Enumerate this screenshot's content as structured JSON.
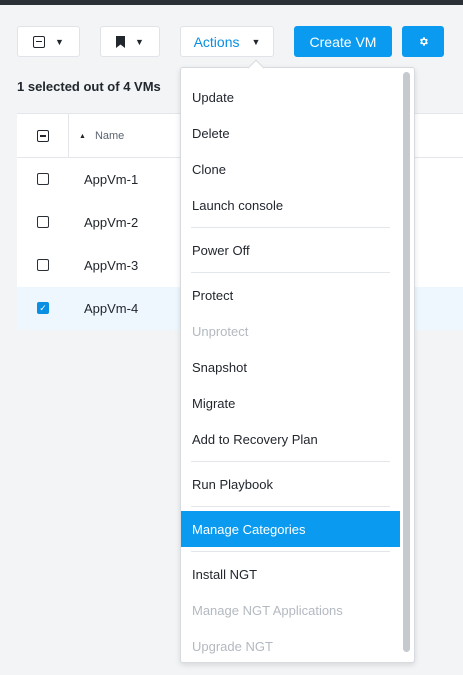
{
  "toolbar": {
    "actions_label": "Actions",
    "create_vm_label": "Create VM"
  },
  "summary": "1 selected out of 4 VMs",
  "table": {
    "header_name": "Name",
    "rows": [
      {
        "name": "AppVm-1",
        "checked": false
      },
      {
        "name": "AppVm-2",
        "checked": false
      },
      {
        "name": "AppVm-3",
        "checked": false
      },
      {
        "name": "AppVm-4",
        "checked": true
      }
    ]
  },
  "menu": {
    "items": [
      {
        "label": "Update"
      },
      {
        "label": "Delete"
      },
      {
        "label": "Clone"
      },
      {
        "label": "Launch console"
      },
      {
        "label": "Power Off"
      },
      {
        "label": "Protect"
      },
      {
        "label": "Unprotect",
        "disabled": true
      },
      {
        "label": "Snapshot"
      },
      {
        "label": "Migrate"
      },
      {
        "label": "Add to Recovery Plan"
      },
      {
        "label": "Run Playbook"
      },
      {
        "label": "Manage Categories",
        "active": true
      },
      {
        "label": "Install NGT"
      },
      {
        "label": "Manage NGT Applications",
        "disabled": true
      },
      {
        "label": "Upgrade NGT",
        "disabled": true
      }
    ]
  },
  "colors": {
    "accent": "#0a9bf0",
    "topbar": "#2b3036",
    "disabled_text": "#b3b9c0"
  }
}
